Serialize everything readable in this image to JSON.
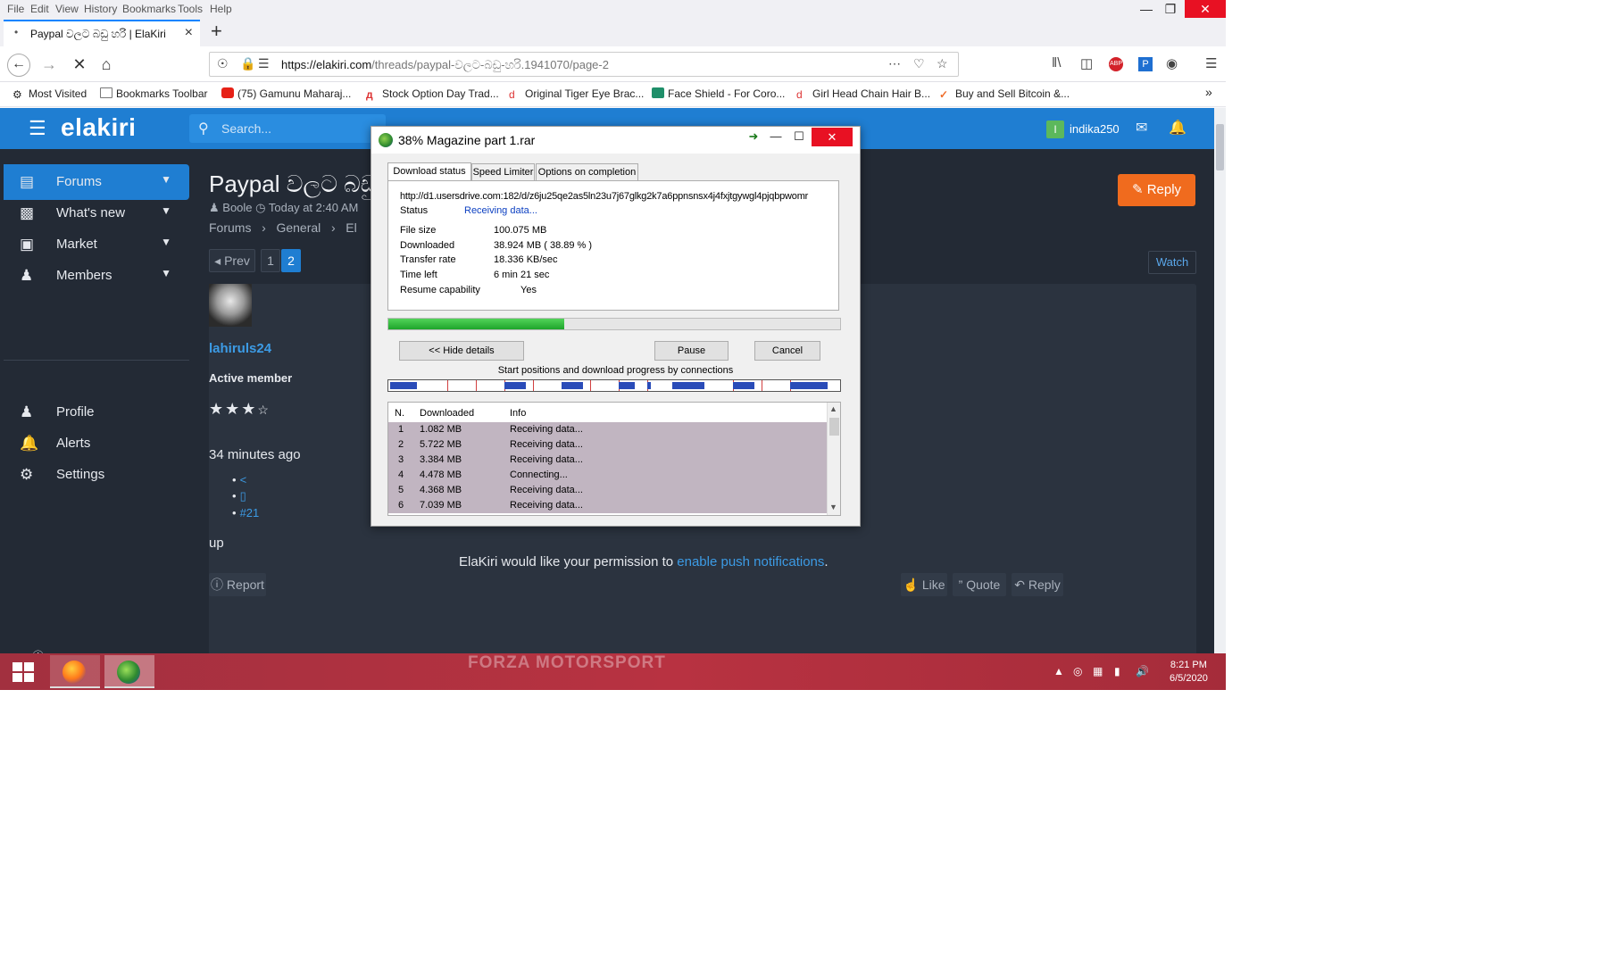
{
  "browser": {
    "menu": [
      "File",
      "Edit",
      "View",
      "History",
      "Bookmarks",
      "Tools",
      "Help"
    ],
    "tab_title": "Paypal වලට බඩු හරි | ElaKiri",
    "url_host": "https://elakiri.com",
    "url_path": "/threads/paypal-වලට-බඩු-හරි.1941070/page-2",
    "bookmarks": [
      "Most Visited",
      "Bookmarks Toolbar",
      "(75) Gamunu Maharaj...",
      "Stock Option Day Trad...",
      "Original Tiger Eye Brac...",
      "Face Shield - For Coro...",
      "Girl Head Chain Hair B...",
      "Buy and Sell Bitcoin &..."
    ]
  },
  "site": {
    "logo": "elakiri",
    "search_placeholder": "Search...",
    "user": {
      "initial": "I",
      "name": "indika250"
    },
    "sidebar": [
      {
        "icon": "forums-icon",
        "label": "Forums"
      },
      {
        "icon": "whats-new-icon",
        "label": "What's new"
      },
      {
        "icon": "market-icon",
        "label": "Market"
      },
      {
        "icon": "members-icon",
        "label": "Members"
      },
      {
        "icon": "profile-icon",
        "label": "Profile"
      },
      {
        "icon": "alerts-icon",
        "label": "Alerts"
      },
      {
        "icon": "settings-icon",
        "label": "Settings"
      }
    ],
    "thread_title": "Paypal වලට බඩු",
    "meta_author": "Boole",
    "meta_time": "Today at 2:40 AM",
    "breadcrumbs": [
      "Forums",
      "General",
      "El"
    ],
    "reply_label": "Reply",
    "pager": {
      "prev": "Prev",
      "pages": [
        "1",
        "2"
      ]
    },
    "watch_label": "Watch",
    "post": {
      "username": "lahiruls24",
      "user_title": "Active member",
      "time_ago": "34 minutes ago",
      "post_number": "#21",
      "body": "up",
      "report": "Report",
      "like": "Like",
      "quote": "Quote",
      "reply": "Reply"
    },
    "notice_text": "ElaKiri would like your permission to",
    "notice_link": "enable push notifications",
    "notice_end": "."
  },
  "idm": {
    "title": "38% Magazine part 1.rar",
    "tabs": [
      "Download status",
      "Speed Limiter",
      "Options on completion"
    ],
    "url": "http://d1.usersdrive.com:182/d/z6ju25qe2as5ln23u7j67glkg2k7a6ppnsnsx4j4fxjtgywgl4pjqbpwomr",
    "status_label": "Status",
    "status_value": "Receiving data...",
    "file_size_label": "File size",
    "file_size": "100.075  MB",
    "downloaded_label": "Downloaded",
    "downloaded": "38.924  MB  ( 38.89 % )",
    "transfer_rate_label": "Transfer rate",
    "transfer_rate": "18.336  KB/sec",
    "time_left_label": "Time left",
    "time_left": "6 min 21 sec",
    "resume_label": "Resume capability",
    "resume_value": "Yes",
    "progress": 0.3889,
    "hide_details": "<< Hide details",
    "pause": "Pause",
    "cancel": "Cancel",
    "connections_label": "Start positions and download progress by connections",
    "table_headers": [
      "N.",
      "Downloaded",
      "Info"
    ],
    "connections": [
      {
        "n": "1",
        "downloaded": "1.082  MB",
        "info": "Receiving data..."
      },
      {
        "n": "2",
        "downloaded": "5.722  MB",
        "info": "Receiving data..."
      },
      {
        "n": "3",
        "downloaded": "3.384  MB",
        "info": "Receiving data..."
      },
      {
        "n": "4",
        "downloaded": "4.478  MB",
        "info": "Connecting..."
      },
      {
        "n": "5",
        "downloaded": "4.368  MB",
        "info": "Receiving data..."
      },
      {
        "n": "6",
        "downloaded": "7.039  MB",
        "info": "Receiving data..."
      }
    ]
  },
  "taskbar": {
    "watermark": "FORZA MOTORSPORT",
    "time": "8:21 PM",
    "date": "6/5/2020"
  },
  "colors": {
    "site_bg": "#232a35",
    "site_header": "#1f7ed2",
    "reply_orange": "#f06b1e",
    "taskbar": "#b83241",
    "idm_progress": "#1ea52b"
  }
}
